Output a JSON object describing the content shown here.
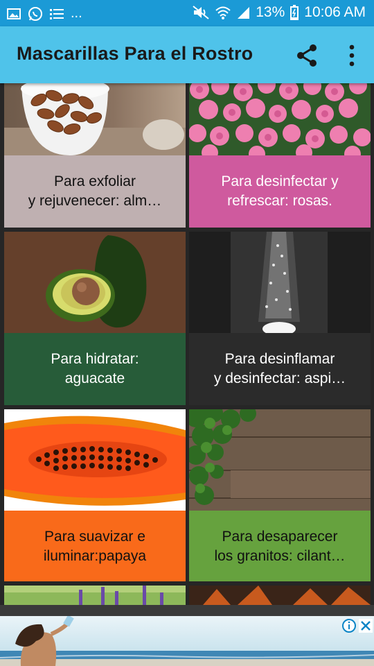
{
  "status_bar": {
    "battery": "13%",
    "time": "10:06 AM",
    "more": "...",
    "icons": [
      "image-icon",
      "whatsapp-icon",
      "list-icon",
      "mute-icon",
      "wifi-icon",
      "signal-icon",
      "battery-icon"
    ]
  },
  "app_bar": {
    "title": "Mascarillas Para el Rostro",
    "actions": [
      "share-icon",
      "more-vert-icon"
    ]
  },
  "cards": [
    {
      "caption": "Para exfoliar\ny rejuvenecer: alm…",
      "bg": "#bfb0b1",
      "image": "almonds"
    },
    {
      "caption": "Para desinfectar y\nrefrescar: rosas.",
      "bg": "#cf5a9e",
      "image": "roses"
    },
    {
      "caption": "Para hidratar:\naguacate",
      "bg": "#275c39",
      "image": "avocado"
    },
    {
      "caption": "Para desinflamar\ny desinfectar: aspi…",
      "bg": "#2b2b2b",
      "image": "aspirin"
    },
    {
      "caption": "Para suavizar e\niluminar:papaya",
      "bg": "#f96a1a",
      "image": "papaya"
    },
    {
      "caption": "Para desaparecer\nlos granitos: cilant…",
      "bg": "#66a23e",
      "image": "cilantro"
    }
  ],
  "ad_banner": {
    "icons": [
      "info-icon",
      "close-icon"
    ]
  }
}
